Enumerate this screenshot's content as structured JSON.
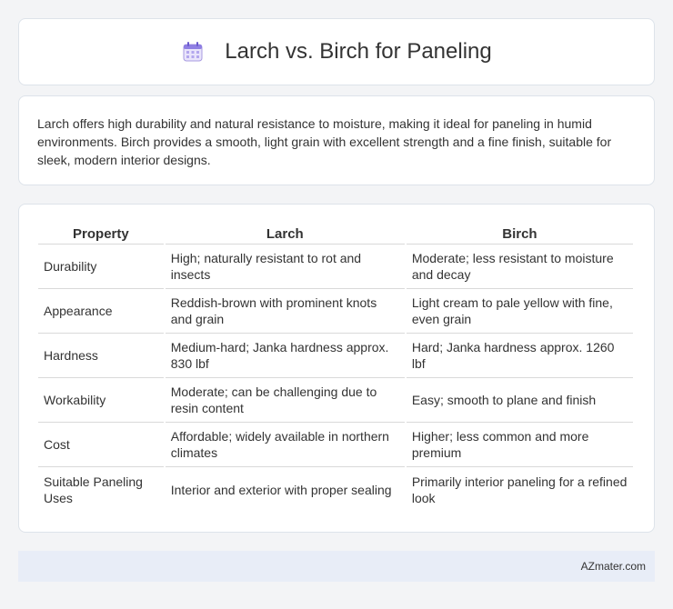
{
  "header": {
    "title": "Larch vs. Birch for Paneling",
    "icon": "calendar-icon"
  },
  "intro": {
    "text": "Larch offers high durability and natural resistance to moisture, making it ideal for paneling in humid environments. Birch provides a smooth, light grain with excellent strength and a fine finish, suitable for sleek, modern interior designs."
  },
  "table": {
    "headers": [
      "Property",
      "Larch",
      "Birch"
    ],
    "rows": [
      [
        "Durability",
        "High; naturally resistant to rot and insects",
        "Moderate; less resistant to moisture and decay"
      ],
      [
        "Appearance",
        "Reddish-brown with prominent knots and grain",
        "Light cream to pale yellow with fine, even grain"
      ],
      [
        "Hardness",
        "Medium-hard; Janka hardness approx. 830 lbf",
        "Hard; Janka hardness approx. 1260 lbf"
      ],
      [
        "Workability",
        "Moderate; can be challenging due to resin content",
        "Easy; smooth to plane and finish"
      ],
      [
        "Cost",
        "Affordable; widely available in northern climates",
        "Higher; less common and more premium"
      ],
      [
        "Suitable Paneling Uses",
        "Interior and exterior with proper sealing",
        "Primarily interior paneling for a refined look"
      ]
    ]
  },
  "footer": {
    "text": "AZmater.com"
  }
}
